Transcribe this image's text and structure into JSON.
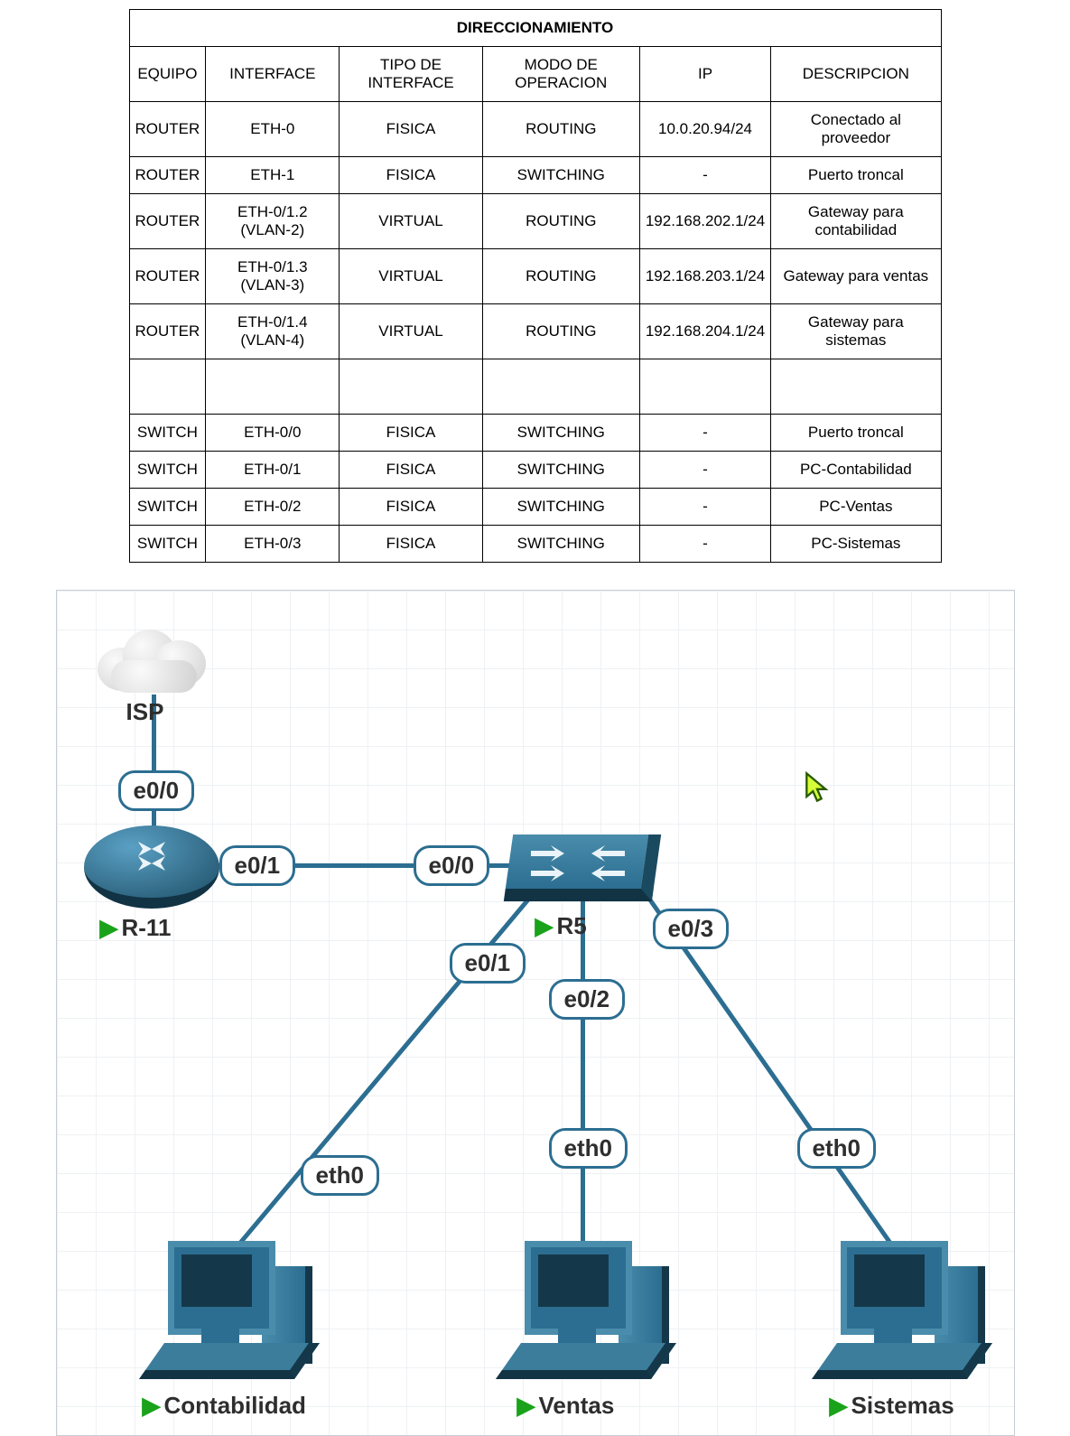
{
  "table": {
    "title": "DIRECCIONAMIENTO",
    "headers": [
      "EQUIPO",
      "INTERFACE",
      "TIPO DE INTERFACE",
      "MODO DE OPERACION",
      "IP",
      "DESCRIPCION"
    ],
    "rows": [
      {
        "equipo": "ROUTER",
        "interface": "ETH-0",
        "tipo": "FISICA",
        "modo": "ROUTING",
        "ip": "10.0.20.94/24",
        "desc": "Conectado al proveedor"
      },
      {
        "equipo": "ROUTER",
        "interface": "ETH-1",
        "tipo": "FISICA",
        "modo": "SWITCHING",
        "ip": "-",
        "desc": "Puerto troncal"
      },
      {
        "equipo": "ROUTER",
        "interface": "ETH-0/1.2 (VLAN-2)",
        "tipo": "VIRTUAL",
        "modo": "ROUTING",
        "ip": "192.168.202.1/24",
        "desc": "Gateway para contabilidad"
      },
      {
        "equipo": "ROUTER",
        "interface": "ETH-0/1.3 (VLAN-3)",
        "tipo": "VIRTUAL",
        "modo": "ROUTING",
        "ip": "192.168.203.1/24",
        "desc": "Gateway para ventas"
      },
      {
        "equipo": "ROUTER",
        "interface": "ETH-0/1.4 (VLAN-4)",
        "tipo": "VIRTUAL",
        "modo": "ROUTING",
        "ip": "192.168.204.1/24",
        "desc": "Gateway para sistemas"
      },
      {
        "equipo": "",
        "interface": "",
        "tipo": "",
        "modo": "",
        "ip": "",
        "desc": ""
      },
      {
        "equipo": "SWITCH",
        "interface": "ETH-0/0",
        "tipo": "FISICA",
        "modo": "SWITCHING",
        "ip": "-",
        "desc": "Puerto troncal"
      },
      {
        "equipo": "SWITCH",
        "interface": "ETH-0/1",
        "tipo": "FISICA",
        "modo": "SWITCHING",
        "ip": "-",
        "desc": "PC-Contabilidad"
      },
      {
        "equipo": "SWITCH",
        "interface": "ETH-0/2",
        "tipo": "FISICA",
        "modo": "SWITCHING",
        "ip": "-",
        "desc": "PC-Ventas"
      },
      {
        "equipo": "SWITCH",
        "interface": "ETH-0/3",
        "tipo": "FISICA",
        "modo": "SWITCHING",
        "ip": "-",
        "desc": "PC-Sistemas"
      }
    ]
  },
  "diagram": {
    "nodes": {
      "isp": {
        "label": "ISP"
      },
      "router": {
        "label": "R-11"
      },
      "switch": {
        "label": "R5"
      },
      "pc1": {
        "label": "Contabilidad"
      },
      "pc2": {
        "label": "Ventas"
      },
      "pc3": {
        "label": "Sistemas"
      }
    },
    "iface_labels": {
      "r_e00": "e0/0",
      "r_e01": "e0/1",
      "s_e00": "e0/0",
      "s_e01": "e0/1",
      "s_e02": "e0/2",
      "s_e03": "e0/3",
      "pc1_eth": "eth0",
      "pc2_eth": "eth0",
      "pc3_eth": "eth0"
    }
  }
}
